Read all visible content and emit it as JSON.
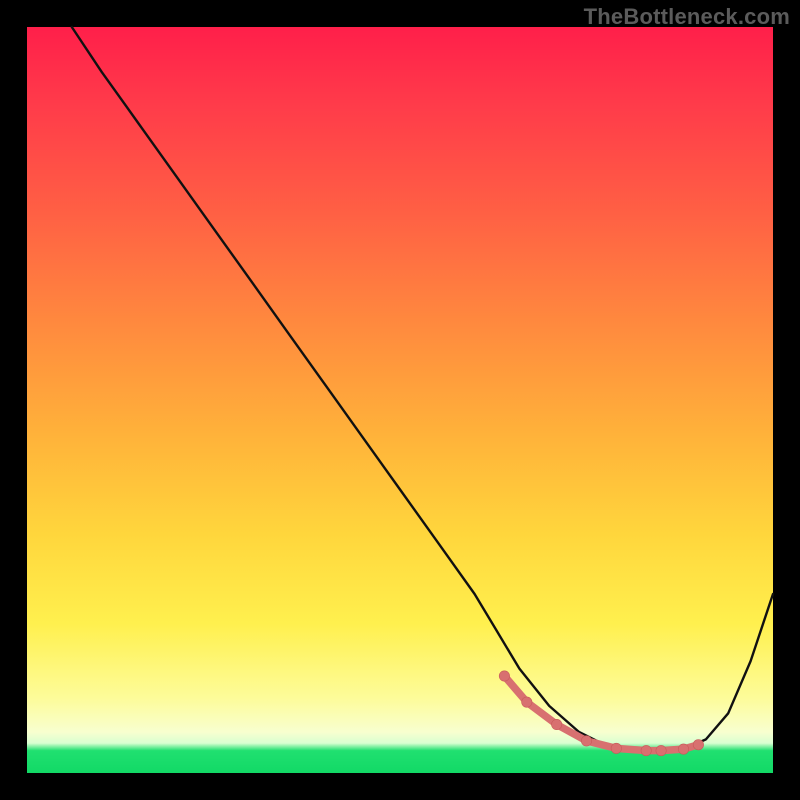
{
  "watermark": "TheBottleneck.com",
  "chart_data": {
    "type": "line",
    "title": "",
    "xlabel": "",
    "ylabel": "",
    "xlim": [
      0,
      100
    ],
    "ylim": [
      0,
      100
    ],
    "series": [
      {
        "name": "bottleneck-curve",
        "x": [
          6,
          10,
          15,
          20,
          25,
          30,
          35,
          40,
          45,
          50,
          55,
          60,
          63,
          66,
          70,
          74,
          78,
          82,
          85,
          88,
          91,
          94,
          97,
          100
        ],
        "y": [
          100,
          94,
          87,
          80,
          73,
          66,
          59,
          52,
          45,
          38,
          31,
          24,
          19,
          14,
          9,
          5.5,
          3.5,
          3,
          3,
          3.2,
          4.5,
          8,
          15,
          24
        ]
      }
    ],
    "markers": {
      "name": "highlighted-range",
      "x": [
        64,
        67,
        71,
        75,
        79,
        83,
        85,
        88,
        90
      ],
      "y": [
        13,
        9.5,
        6.5,
        4.3,
        3.3,
        3,
        3,
        3.2,
        3.8
      ]
    },
    "gradient_stops": [
      {
        "pos": 0.0,
        "color": "#ff1f4a"
      },
      {
        "pos": 0.55,
        "color": "#ffb33a"
      },
      {
        "pos": 0.9,
        "color": "#fdfc9a"
      },
      {
        "pos": 0.97,
        "color": "#20e070"
      },
      {
        "pos": 1.0,
        "color": "#12d966"
      }
    ]
  }
}
